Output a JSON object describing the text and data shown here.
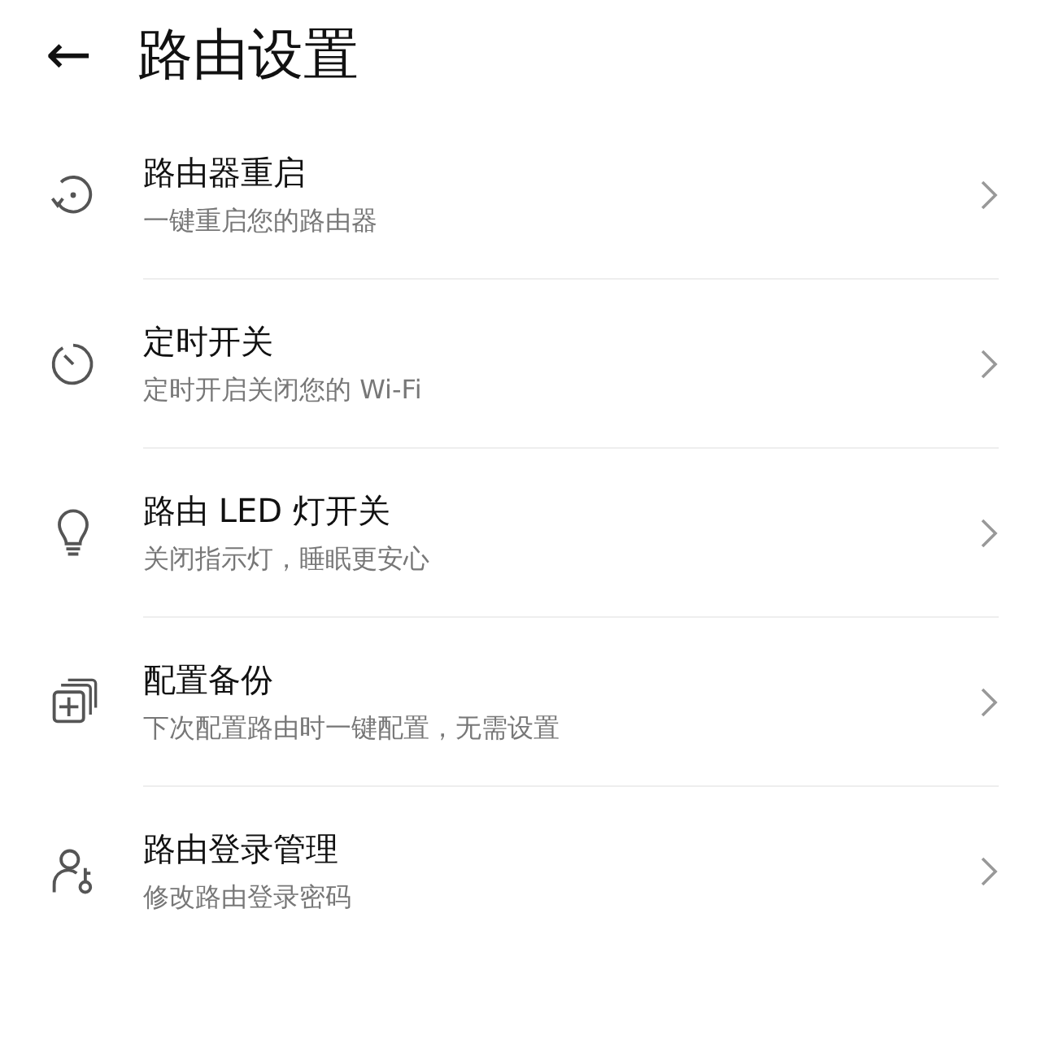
{
  "header": {
    "back": "←",
    "title": "路由设置"
  },
  "items": [
    {
      "kind": "restart",
      "title": "路由器重启",
      "subtitle": "一键重启您的路由器"
    },
    {
      "kind": "timer",
      "title": "定时开关",
      "subtitle": "定时开启关闭您的 Wi-Fi"
    },
    {
      "kind": "bulb",
      "title": "路由 LED 灯开关",
      "subtitle": "关闭指示灯，睡眠更安心"
    },
    {
      "kind": "backup",
      "title": "配置备份",
      "subtitle": "下次配置路由时一键配置，无需设置"
    },
    {
      "kind": "user-key",
      "title": "路由登录管理",
      "subtitle": "修改路由登录密码"
    }
  ]
}
